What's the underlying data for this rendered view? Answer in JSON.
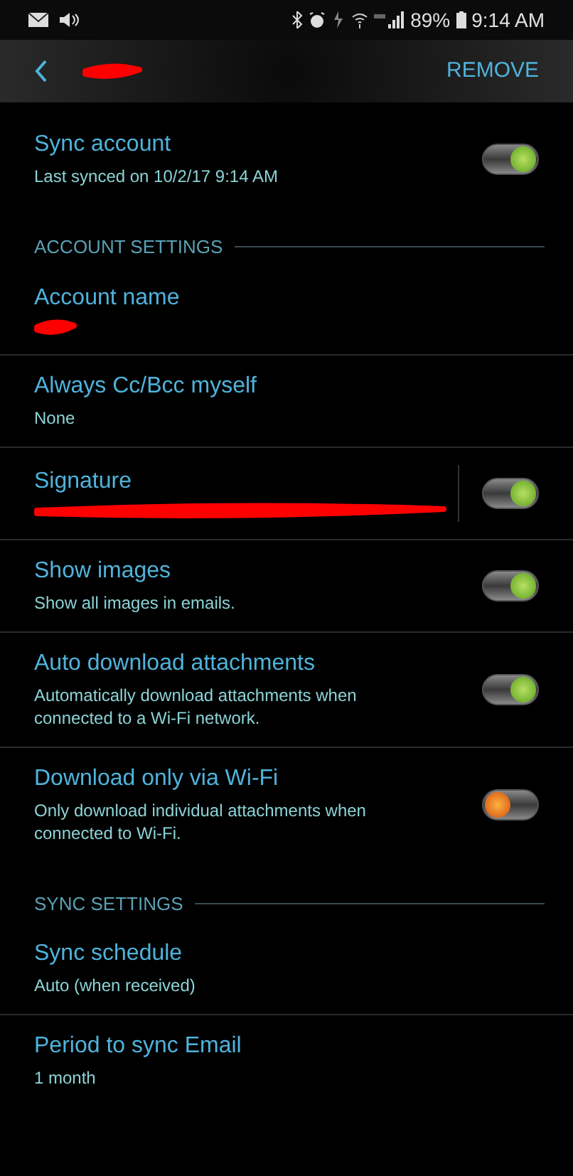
{
  "status_bar": {
    "battery": "89%",
    "time": "9:14 AM"
  },
  "toolbar": {
    "action": "REMOVE"
  },
  "items": [
    {
      "kind": "switch",
      "title": "Sync account",
      "summary": "Last synced on 10/2/17  9:14 AM",
      "on": true
    },
    {
      "kind": "header",
      "title": "ACCOUNT SETTINGS"
    },
    {
      "kind": "setting",
      "title": "Account name",
      "redacted": true
    },
    {
      "kind": "setting",
      "title": "Always Cc/Bcc myself",
      "summary": "None"
    },
    {
      "kind": "switch",
      "title": "Signature",
      "redacted": true,
      "on": true,
      "divider": true
    },
    {
      "kind": "switch",
      "title": "Show images",
      "summary": "Show all images in emails.",
      "on": true
    },
    {
      "kind": "switch",
      "title": "Auto download attachments",
      "summary": "Automatically download attachments when connected to a Wi-Fi network.",
      "on": true
    },
    {
      "kind": "switch",
      "title": "Download only via Wi-Fi",
      "summary": "Only download individual attachments when connected to Wi-Fi.",
      "on": false
    },
    {
      "kind": "header",
      "title": "SYNC SETTINGS"
    },
    {
      "kind": "setting",
      "title": "Sync schedule",
      "summary": "Auto (when received)"
    },
    {
      "kind": "setting",
      "title": "Period to sync Email",
      "summary": "1 month"
    }
  ]
}
